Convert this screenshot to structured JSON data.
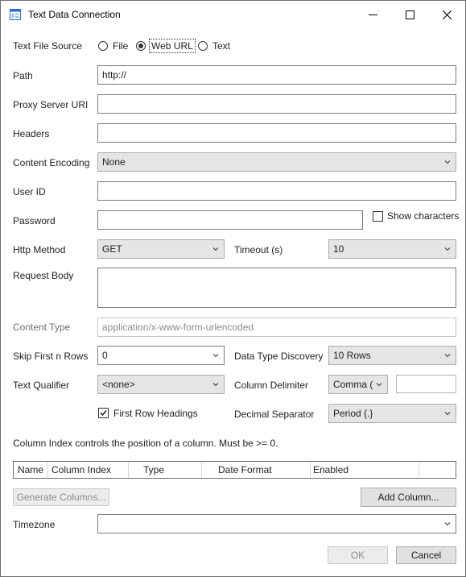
{
  "window": {
    "title": "Text Data Connection",
    "minimize_icon": "minimize-icon",
    "maximize_icon": "maximize-icon",
    "close_icon": "close-icon"
  },
  "source": {
    "label": "Text File Source",
    "options": [
      "File",
      "Web URL",
      "Text"
    ],
    "selected": "Web URL"
  },
  "path": {
    "label": "Path",
    "value": "http://"
  },
  "proxy": {
    "label": "Proxy Server URI",
    "value": ""
  },
  "headers": {
    "label": "Headers",
    "value": ""
  },
  "encoding": {
    "label": "Content Encoding",
    "value": "None"
  },
  "user_id": {
    "label": "User ID",
    "value": ""
  },
  "password": {
    "label": "Password",
    "value": "",
    "show_chars_label": "Show characters",
    "show_chars_checked": false
  },
  "http_method": {
    "label": "Http Method",
    "value": "GET"
  },
  "timeout": {
    "label": "Timeout (s)",
    "value": "10"
  },
  "request_body": {
    "label": "Request Body",
    "value": ""
  },
  "content_type": {
    "label": "Content Type",
    "placeholder": "application/x-www-form-urlencoded"
  },
  "skip_rows": {
    "label": "Skip First n Rows",
    "value": "0"
  },
  "type_discovery": {
    "label": "Data Type Discovery",
    "value": "10 Rows"
  },
  "text_qualifier": {
    "label": "Text Qualifier",
    "value": "<none>"
  },
  "column_delimiter": {
    "label": "Column Delimiter",
    "value": "Comma (",
    "extra": ""
  },
  "first_row": {
    "label": "First Row Headings",
    "checked": true
  },
  "decimal_separator": {
    "label": "Decimal Separator",
    "value": "Period {.}"
  },
  "column_note": "Column Index controls the position of a column. Must be >= 0.",
  "grid_columns": [
    "Name",
    "Column Index",
    "Type",
    "Date Format",
    "Enabled"
  ],
  "buttons": {
    "generate": "Generate Columns...",
    "add_column": "Add Column...",
    "ok": "OK",
    "cancel": "Cancel"
  },
  "timezone": {
    "label": "Timezone",
    "value": ""
  },
  "colors": {
    "border": "#7a7a7a",
    "combo_bg": "#e5e5e5",
    "button_bg": "#e1e1e1",
    "disabled_text": "#8c8c8c"
  }
}
